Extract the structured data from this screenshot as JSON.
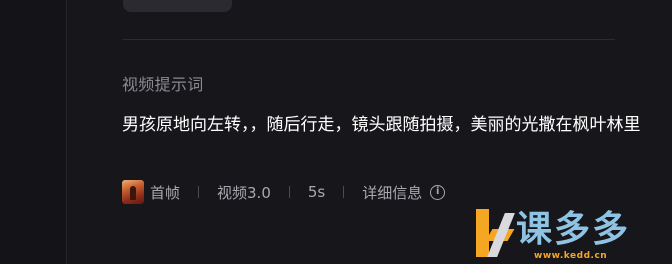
{
  "prompt_section": {
    "label": "视频提示词",
    "text": "男孩原地向左转，，随后行走，镜头跟随拍摄，美丽的光撒在枫叶林里"
  },
  "meta": {
    "first_frame_label": "首帧",
    "model": "视频3.0",
    "duration": "5s",
    "details_label": "详细信息",
    "info_icon": "info-icon"
  },
  "watermark": {
    "text": "课多多",
    "url": "www.kedd.cn",
    "colors": {
      "orange": "#f5a623",
      "blue": "#8fc3e3"
    }
  },
  "colors": {
    "background": "#17161b",
    "text_primary": "#ffffff",
    "text_secondary": "#8a8990",
    "meta_text": "#a9a8ae"
  }
}
